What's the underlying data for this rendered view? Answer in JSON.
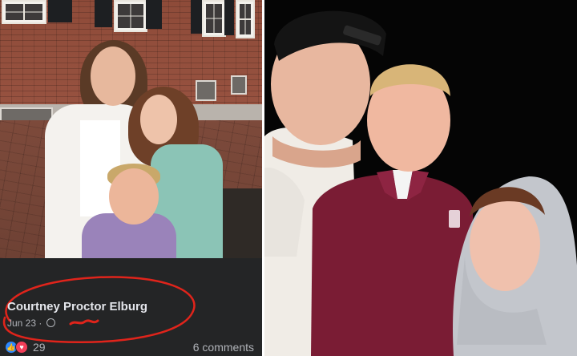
{
  "post": {
    "author_name": "Courtney Proctor Elburg",
    "date": "Jun 23",
    "separator": "·",
    "reaction_count": "29",
    "comments_label": "6 comments"
  },
  "colors": {
    "fb_background": "#242526",
    "fb_text_primary": "#e4e6eb",
    "fb_text_secondary": "#b0b3b8",
    "like_blue": "#2d88ff",
    "love_red": "#f33e58",
    "annotation_red": "#e0241b"
  },
  "icons": {
    "like": "like-icon",
    "love": "heart-icon",
    "audience": "globe-icon"
  }
}
